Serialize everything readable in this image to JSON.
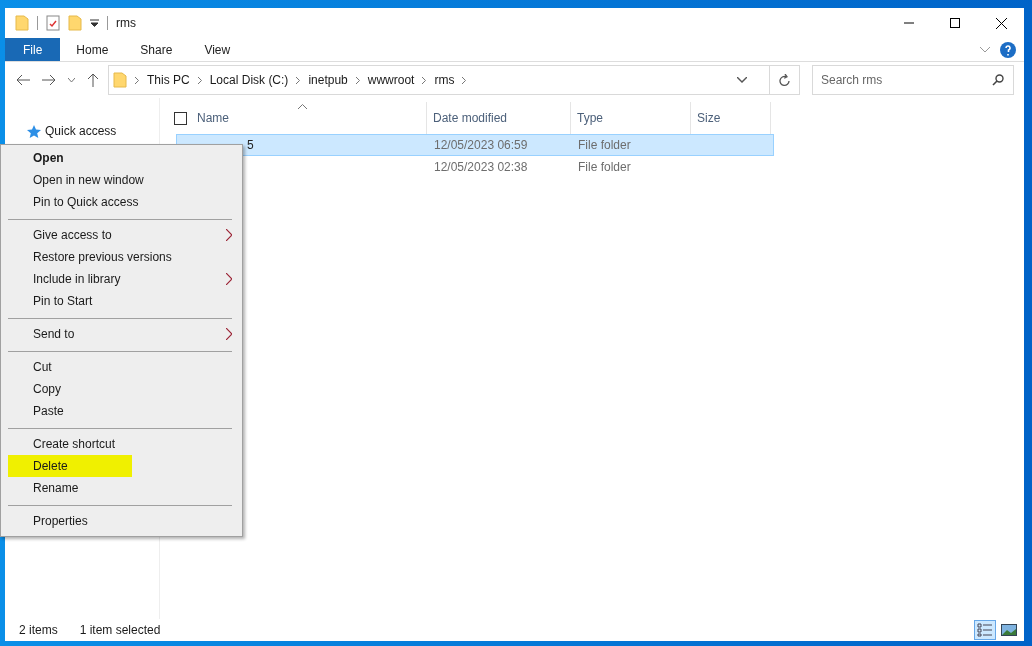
{
  "window": {
    "title": "rms"
  },
  "ribbon": {
    "tabs": [
      {
        "label": "File",
        "kind": "file"
      },
      {
        "label": "Home",
        "kind": "tab"
      },
      {
        "label": "Share",
        "kind": "tab"
      },
      {
        "label": "View",
        "kind": "tab"
      }
    ]
  },
  "address": {
    "crumbs": [
      "This PC",
      "Local Disk (C:)",
      "inetpub",
      "wwwroot",
      "rms"
    ]
  },
  "search": {
    "placeholder": "Search rms"
  },
  "navigation": {
    "items": [
      {
        "label": "Quick access"
      }
    ]
  },
  "table": {
    "select_all": {
      "checked": false
    },
    "columns": [
      "Name",
      "Date modified",
      "Type",
      "Size"
    ],
    "rows": [
      {
        "name": "5",
        "date": "12/05/2023 06:59",
        "type": "File folder",
        "selected": true
      },
      {
        "date": "12/05/2023 02:38",
        "type": "File folder",
        "selected": false
      }
    ]
  },
  "context_menu": {
    "groups": [
      [
        {
          "label": "Open",
          "default": true,
          "submenu": false,
          "highlighted": false
        },
        {
          "label": "Open in new window",
          "default": false,
          "submenu": false,
          "highlighted": false
        },
        {
          "label": "Pin to Quick access",
          "default": false,
          "submenu": false,
          "highlighted": false
        }
      ],
      [
        {
          "label": "Give access to",
          "default": false,
          "submenu": true,
          "highlighted": false
        },
        {
          "label": "Restore previous versions",
          "default": false,
          "submenu": false,
          "highlighted": false
        },
        {
          "label": "Include in library",
          "default": false,
          "submenu": true,
          "highlighted": false
        },
        {
          "label": "Pin to Start",
          "default": false,
          "submenu": false,
          "highlighted": false
        }
      ],
      [
        {
          "label": "Send to",
          "default": false,
          "submenu": true,
          "highlighted": false
        }
      ],
      [
        {
          "label": "Cut",
          "default": false,
          "submenu": false,
          "highlighted": false
        },
        {
          "label": "Copy",
          "default": false,
          "submenu": false,
          "highlighted": false
        },
        {
          "label": "Paste",
          "default": false,
          "submenu": false,
          "highlighted": false
        }
      ],
      [
        {
          "label": "Create shortcut",
          "default": false,
          "submenu": false,
          "highlighted": false
        },
        {
          "label": "Delete",
          "default": false,
          "submenu": false,
          "highlighted": true
        },
        {
          "label": "Rename",
          "default": false,
          "submenu": false,
          "highlighted": false
        }
      ],
      [
        {
          "label": "Properties",
          "default": false,
          "submenu": false,
          "highlighted": false
        }
      ]
    ]
  },
  "status_bar": {
    "texts": [
      "2 items",
      "1 item selected"
    ],
    "views": [
      {
        "kind": "details",
        "selected": true
      },
      {
        "kind": "large-icons",
        "selected": false
      }
    ]
  }
}
